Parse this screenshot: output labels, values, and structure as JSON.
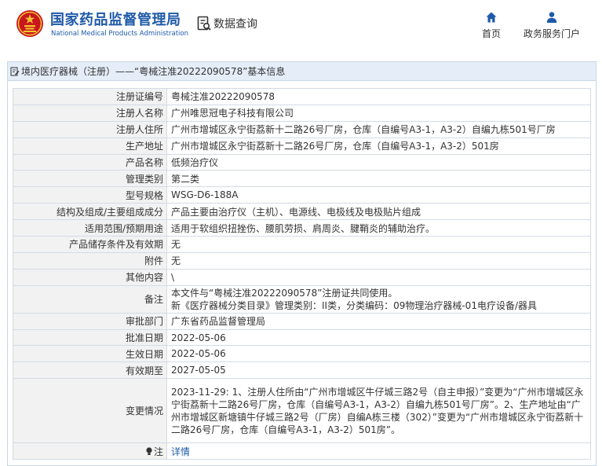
{
  "header": {
    "brand_cn": "国家药品监督管理局",
    "brand_en": "National Medical Products Administration",
    "query_label": "数据查询",
    "nav": [
      {
        "label": "首页",
        "icon": "home-icon"
      },
      {
        "label": "政务服务门户",
        "icon": "user-icon"
      }
    ]
  },
  "panel": {
    "title": "境内医疗器械（注册）——“粤械注准20222090578”基本信息"
  },
  "record": [
    {
      "label": "注册证编号",
      "value": "粤械注准20222090578"
    },
    {
      "label": "注册人名称",
      "value": "广州唯思冠电子科技有限公司"
    },
    {
      "label": "注册人住所",
      "value": "广州市增城区永宁街荔新十二路26号厂房，仓库（自编号A3-1，A3-2）自编九栋501号厂房"
    },
    {
      "label": "生产地址",
      "value": "广州市增城区永宁街荔新十二路26号厂房，仓库（自编号A3-1，A3-2）501房"
    },
    {
      "label": "产品名称",
      "value": "低频治疗仪"
    },
    {
      "label": "管理类别",
      "value": "第二类"
    },
    {
      "label": "型号规格",
      "value": "WSG-D6-188A"
    },
    {
      "label": "结构及组成/主要组成成分",
      "value": "产品主要由治疗仪（主机）、电源线、电极线及电极贴片组成"
    },
    {
      "label": "适用范围/预期用途",
      "value": "适用于软组织扭挫伤、腰肌劳损、肩周炎、腱鞘炎的辅助治疗。"
    },
    {
      "label": "产品储存条件及有效期",
      "value": "无"
    },
    {
      "label": "附件",
      "value": "无"
    },
    {
      "label": "其他内容",
      "value": "\\"
    }
  ],
  "remark": {
    "label": "备注",
    "line1": "本文件与“粤械注准20222090578”注册证共同使用。",
    "line2": "新《医疗器械分类目录》管理类别：II类，分类编码：09物理治疗器械-01电疗设备/器具"
  },
  "record2": [
    {
      "label": "审批部门",
      "value": "广东省药品监督管理局"
    },
    {
      "label": "批准日期",
      "value": "2022-05-06"
    },
    {
      "label": "生效日期",
      "value": "2022-05-06"
    },
    {
      "label": "有效期至",
      "value": "2027-05-05"
    }
  ],
  "changes": {
    "label": "变更情况",
    "text": "2023-11-29: 1、注册人住所由“广州市增城区牛仔城三路2号（自主申报）”变更为“广州市增城区永宁街荔新十二路26号厂房，仓库（自编号A3-1，A3-2）自编九栋501号厂房”。2、生产地址由“广州市增城区新塘镇牛仔城三路2号（厂房）自编A栋三楼（302）”变更为“广州市增城区永宁街荔新十二路26号厂房，仓库（自编号A3-1，A3-2）501房”。"
  },
  "note": {
    "label": "注",
    "icon": "bulb-icon",
    "link": "详情"
  }
}
